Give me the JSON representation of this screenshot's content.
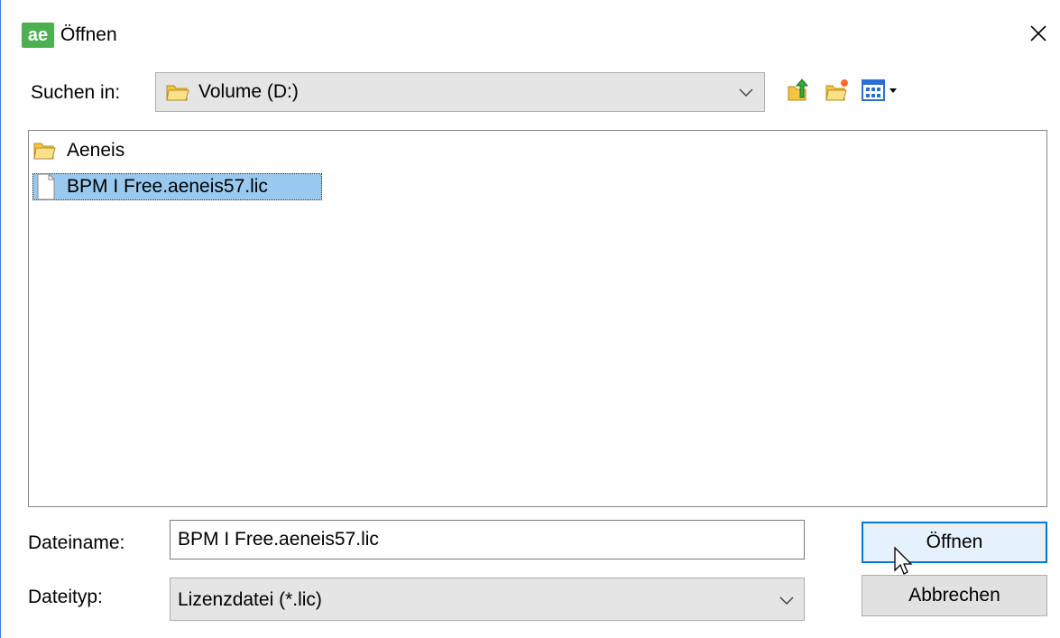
{
  "window": {
    "title": "Öffnen",
    "app_icon_text": "ae"
  },
  "look_in": {
    "label": "Suchen in:",
    "value": "Volume (D:)"
  },
  "toolbar": {
    "up_icon": "up-one-level-icon",
    "new_folder_icon": "new-folder-icon",
    "view_menu_icon": "view-menu-icon"
  },
  "files": [
    {
      "name": "Aeneis",
      "type": "folder",
      "selected": false
    },
    {
      "name": "BPM I Free.aeneis57.lic",
      "type": "file",
      "selected": true
    }
  ],
  "filename": {
    "label": "Dateiname:",
    "value": "BPM I Free.aeneis57.lic"
  },
  "filetype": {
    "label": "Dateityp:",
    "value": "Lizenzdatei (*.lic)"
  },
  "buttons": {
    "open": "Öffnen",
    "cancel": "Abbrechen"
  },
  "colors": {
    "selection": "#99c9ef",
    "accent": "#0078d7",
    "folder": "#f5c542"
  }
}
